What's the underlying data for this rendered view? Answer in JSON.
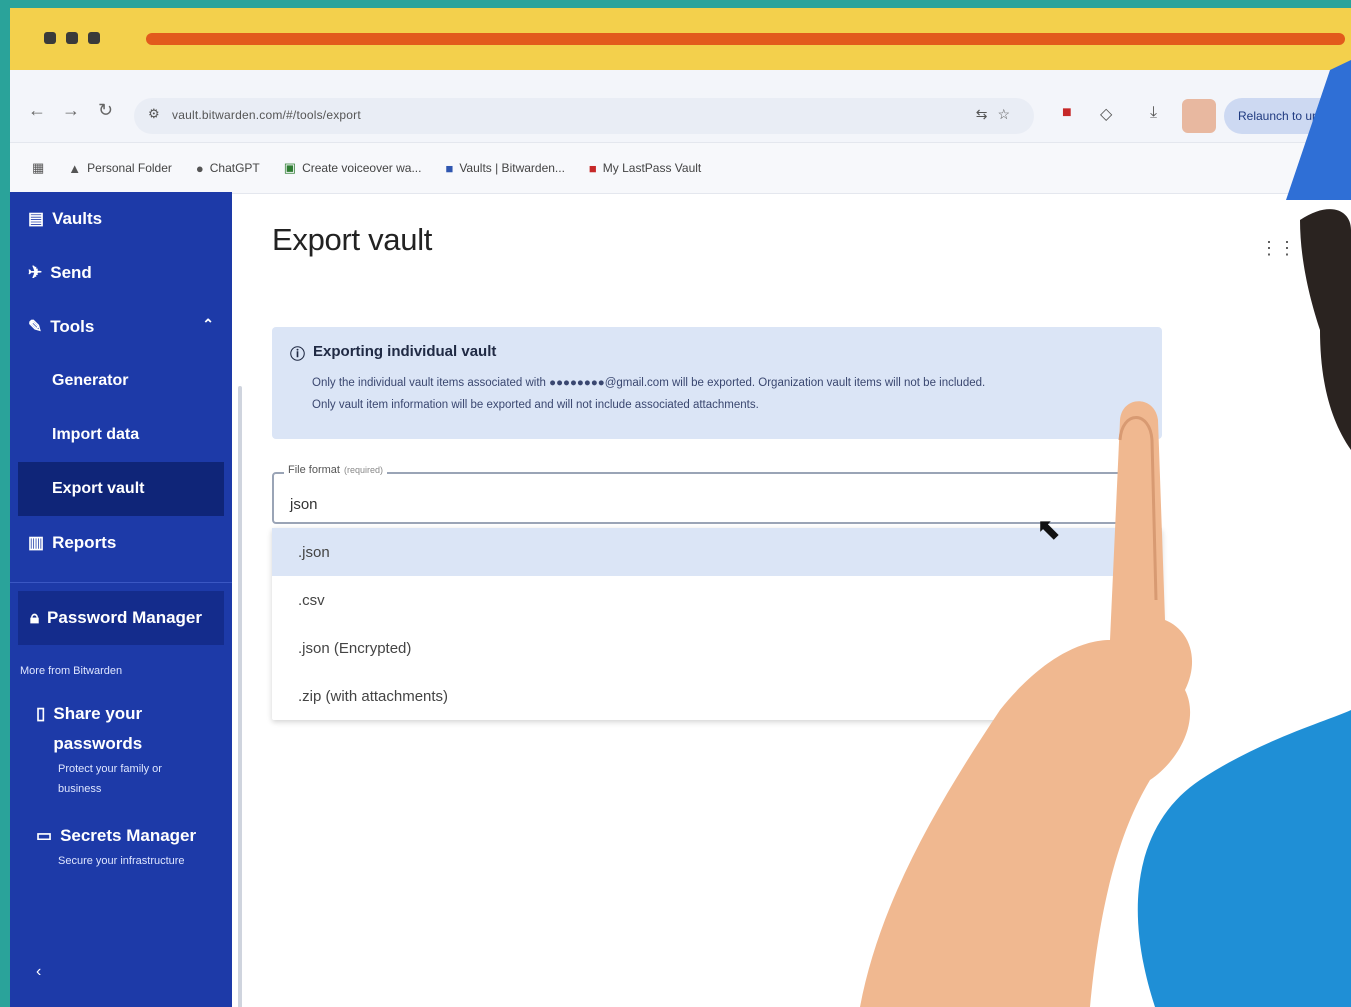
{
  "browser": {
    "url": "vault.bitwarden.com/#/tools/export",
    "relaunch_label": "Relaunch to update"
  },
  "bookmarks": [
    {
      "label": "Personal Folder"
    },
    {
      "label": "ChatGPT"
    },
    {
      "label": "Create voiceover wa..."
    },
    {
      "label": "Vaults | Bitwarden..."
    },
    {
      "label": "My LastPass Vault"
    }
  ],
  "sidebar": {
    "vaults": "Vaults",
    "send": "Send",
    "tools": "Tools",
    "generator": "Generator",
    "import_data": "Import data",
    "export_vault": "Export vault",
    "reports": "Reports",
    "password_manager": "Password Manager",
    "more_from": "More from Bitwarden",
    "share_title": "Share your passwords",
    "share_desc": "Protect your family or business",
    "secrets_title": "Secrets Manager",
    "secrets_desc": "Secure your infrastructure"
  },
  "main": {
    "title": "Export vault",
    "callout_title": "Exporting individual vault",
    "callout_line1": "Only the individual vault items associated with ●●●●●●●●@gmail.com will be exported. Organization vault items will not be included.",
    "callout_line2": "Only vault item information will be exported and will not include associated attachments.",
    "field_label": "File format",
    "field_required": "(required)",
    "field_value": "json"
  },
  "options": [
    {
      "label": ".json"
    },
    {
      "label": ".csv"
    },
    {
      "label": ".json (Encrypted)"
    },
    {
      "label": ".zip (with attachments)"
    }
  ],
  "colors": {
    "sidebar": "#1d3aa8",
    "active": "#0f2578",
    "callout": "#dbe5f6",
    "frame": "#f1d24a",
    "accent_bar": "#e25a1c",
    "shirt": "#1f8fd6",
    "skin": "#f0b890"
  }
}
